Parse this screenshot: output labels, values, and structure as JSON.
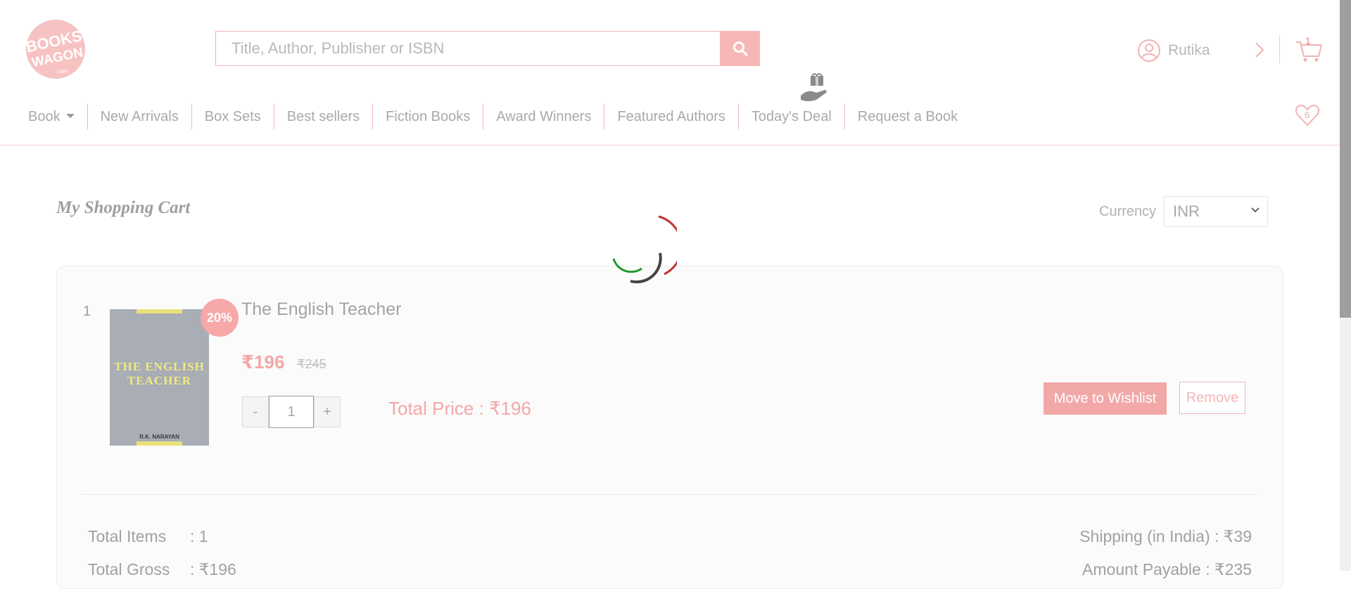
{
  "header": {
    "logo_text": "BOOKS WAGON",
    "search_placeholder": "Title, Author, Publisher or ISBN",
    "user_name": "Rutika",
    "cart_count": "1",
    "wishlist_count": "6"
  },
  "nav": {
    "items": [
      {
        "label": "Book"
      },
      {
        "label": "New Arrivals"
      },
      {
        "label": "Box Sets"
      },
      {
        "label": "Best sellers"
      },
      {
        "label": "Fiction Books"
      },
      {
        "label": "Award Winners"
      },
      {
        "label": "Featured Authors"
      },
      {
        "label": "Today's Deal"
      },
      {
        "label": "Request a Book"
      }
    ]
  },
  "page": {
    "title": "My Shopping Cart",
    "currency_label": "Currency",
    "currency_value": "INR"
  },
  "cart": {
    "items": [
      {
        "index": "1",
        "discount": "20%",
        "title": "The English Teacher",
        "cover_title": "THE ENGLISH TEACHER",
        "cover_author": "R.K. NARAYAN",
        "price": "₹196",
        "original_price": "₹245",
        "quantity": "1",
        "qty_minus": "-",
        "qty_plus": "+",
        "total_price": "Total Price : ₹196",
        "wishlist_label": "Move to Wishlist",
        "remove_label": "Remove"
      }
    ],
    "summary": {
      "total_items_label": "Total Items",
      "total_items_value": ": 1",
      "total_gross_label": "Total Gross",
      "total_gross_value": ": ₹196",
      "shipping": "Shipping (in India) : ₹39",
      "amount_payable": "Amount Payable : ₹235"
    }
  },
  "colors": {
    "accent": "#f3a8a8",
    "accent_light": "#f7b7b7",
    "text_muted": "#a9a9a9"
  }
}
